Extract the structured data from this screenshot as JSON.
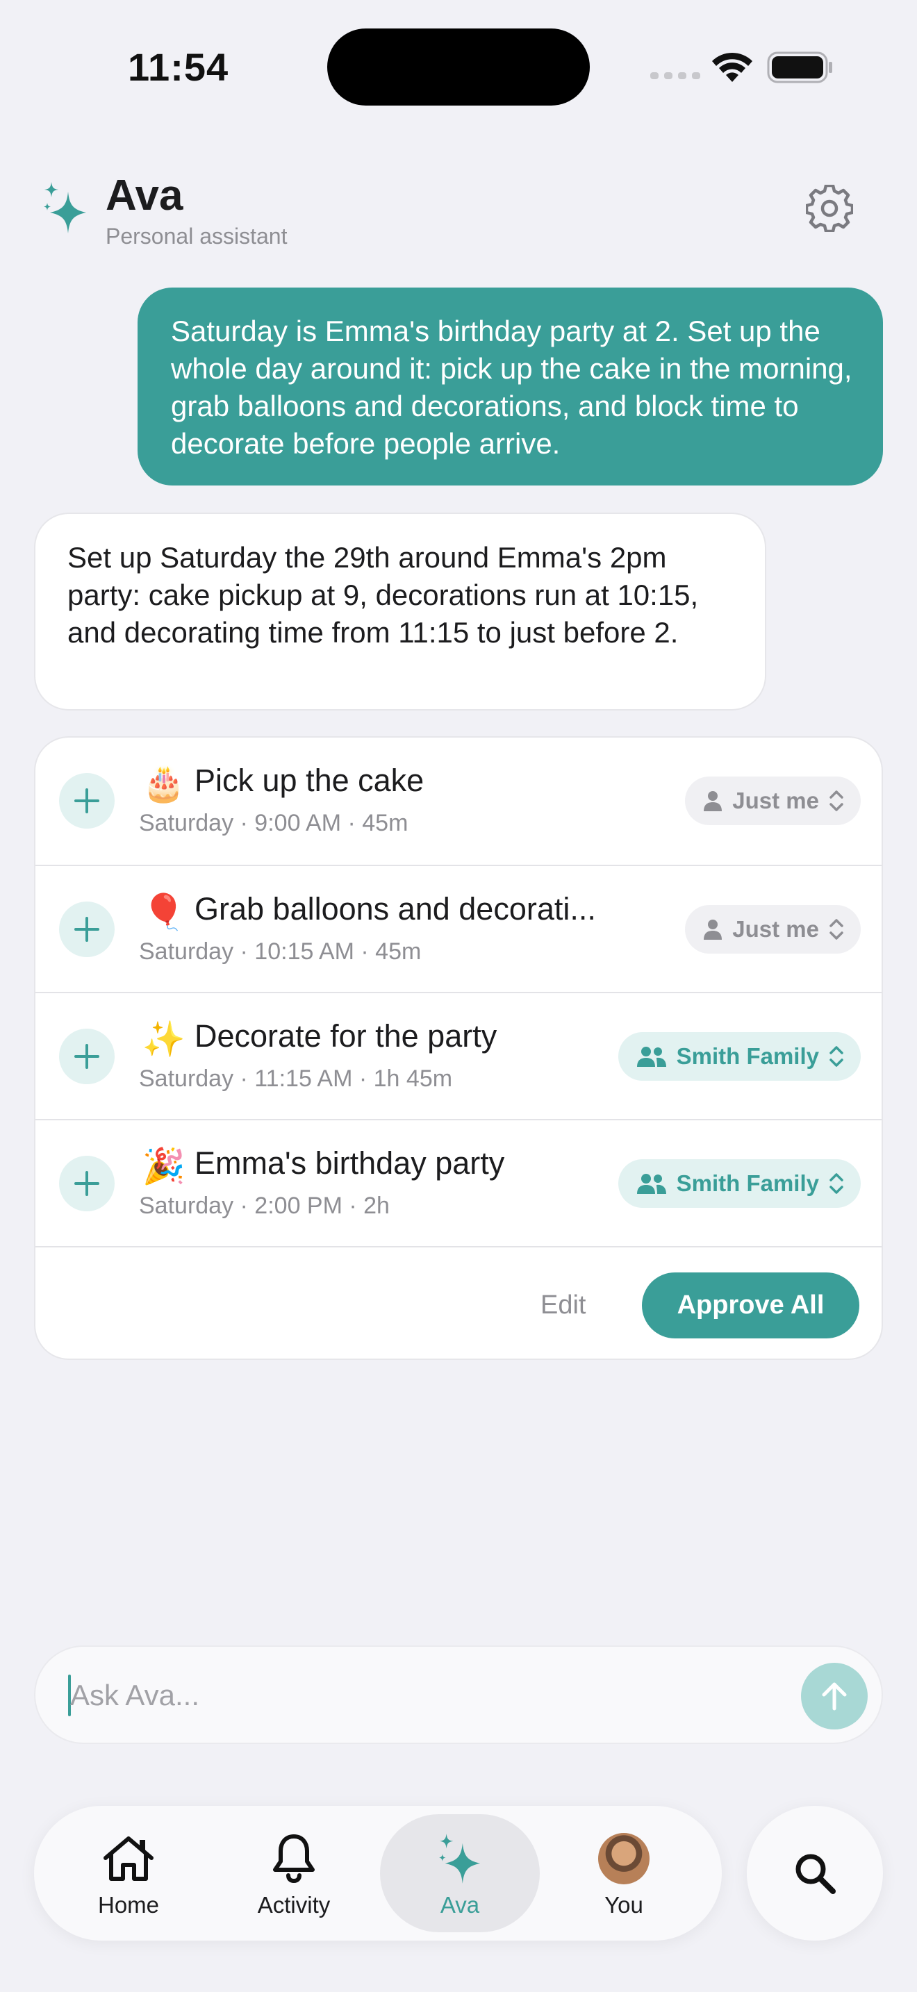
{
  "status_bar": {
    "time": "11:54"
  },
  "header": {
    "title": "Ava",
    "subtitle": "Personal assistant"
  },
  "chat": {
    "user_message": "Saturday is Emma's birthday party at 2. Set up the whole day around it: pick up the cake in the morning, grab balloons and decorations, and block time to decorate before people arrive.",
    "assistant_message": "Set up Saturday the 29th around Emma's 2pm party: cake pickup at 9, decorations run at 10:15, and decorating time from 11:15 to just before 2."
  },
  "events": [
    {
      "emoji": "🎂",
      "title": "Pick up the cake",
      "meta": "Saturday · 9:00 AM · 45m",
      "calendar": "Just me",
      "calendar_type": "me"
    },
    {
      "emoji": "🎈",
      "title": "Grab balloons and decorati...",
      "meta": "Saturday · 10:15 AM · 45m",
      "calendar": "Just me",
      "calendar_type": "me"
    },
    {
      "emoji": "✨",
      "title": "Decorate for the party",
      "meta": "Saturday · 11:15 AM · 1h 45m",
      "calendar": "Smith Family",
      "calendar_type": "family"
    },
    {
      "emoji": "🎉",
      "title": "Emma's birthday party",
      "meta": "Saturday · 2:00 PM · 2h",
      "calendar": "Smith Family",
      "calendar_type": "family"
    }
  ],
  "actions": {
    "edit": "Edit",
    "approve_all": "Approve All"
  },
  "input": {
    "placeholder": "Ask Ava..."
  },
  "tabs": [
    {
      "label": "Home",
      "icon": "house-icon"
    },
    {
      "label": "Activity",
      "icon": "bell-icon"
    },
    {
      "label": "Ava",
      "icon": "sparkles-icon",
      "active": true
    },
    {
      "label": "You",
      "icon": "avatar"
    }
  ],
  "colors": {
    "accent": "#3A9E98",
    "accent_light": "#E2F2F1",
    "background": "#F1F1F6"
  }
}
